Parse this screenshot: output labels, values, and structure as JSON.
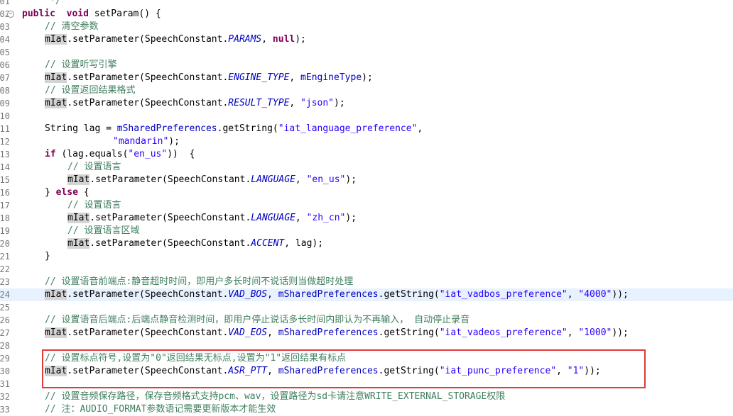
{
  "editor": {
    "annotation_color": "#e03a3a",
    "fold_icon": "collapse-icon",
    "lines": [
      {
        "no": "01",
        "indent": 0,
        "tokens": [
          [
            "cm",
            "     */"
          ]
        ]
      },
      {
        "no": "02",
        "indent": 0,
        "fold": true,
        "tokens": [
          [
            "kw",
            "public"
          ],
          [
            "",
            "  "
          ],
          [
            "kw",
            "void"
          ],
          [
            "",
            " setParam() {"
          ]
        ]
      },
      {
        "no": "03",
        "indent": 2,
        "tokens": [
          [
            "cm",
            "// 清空参数"
          ]
        ]
      },
      {
        "no": "04",
        "indent": 2,
        "tokens": [
          [
            "occ",
            "mIat"
          ],
          [
            "",
            ".setParameter(SpeechConstant."
          ],
          [
            "cst",
            "PARAMS"
          ],
          [
            "",
            ", "
          ],
          [
            "kw",
            "null"
          ],
          [
            "",
            ");"
          ]
        ]
      },
      {
        "no": "05",
        "indent": 0,
        "tokens": []
      },
      {
        "no": "06",
        "indent": 2,
        "tokens": [
          [
            "cm",
            "// 设置听写引擎"
          ]
        ]
      },
      {
        "no": "07",
        "indent": 2,
        "tokens": [
          [
            "occ",
            "mIat"
          ],
          [
            "",
            ".setParameter(SpeechConstant."
          ],
          [
            "cst",
            "ENGINE_TYPE"
          ],
          [
            "",
            ", "
          ],
          [
            "fld",
            "mEngineType"
          ],
          [
            "",
            ");"
          ]
        ]
      },
      {
        "no": "08",
        "indent": 2,
        "tokens": [
          [
            "cm",
            "// 设置返回结果格式"
          ]
        ]
      },
      {
        "no": "09",
        "indent": 2,
        "tokens": [
          [
            "occ",
            "mIat"
          ],
          [
            "",
            ".setParameter(SpeechConstant."
          ],
          [
            "cst",
            "RESULT_TYPE"
          ],
          [
            "",
            ", "
          ],
          [
            "str",
            "\"json\""
          ],
          [
            "",
            ");"
          ]
        ]
      },
      {
        "no": "10",
        "indent": 0,
        "tokens": []
      },
      {
        "no": "11",
        "indent": 2,
        "tokens": [
          [
            "",
            "String lag = "
          ],
          [
            "fld",
            "mSharedPreferences"
          ],
          [
            "",
            ".getString("
          ],
          [
            "str",
            "\"iat_language_preference\""
          ],
          [
            "",
            ","
          ]
        ]
      },
      {
        "no": "12",
        "indent": 8,
        "tokens": [
          [
            "str",
            "\"mandarin\""
          ],
          [
            "",
            ");"
          ]
        ]
      },
      {
        "no": "13",
        "indent": 2,
        "tokens": [
          [
            "kw",
            "if"
          ],
          [
            "",
            " (lag.equals("
          ],
          [
            "str",
            "\"en_us\""
          ],
          [
            "",
            "))  {"
          ]
        ]
      },
      {
        "no": "14",
        "indent": 4,
        "tokens": [
          [
            "cm",
            "// 设置语言"
          ]
        ]
      },
      {
        "no": "15",
        "indent": 4,
        "tokens": [
          [
            "occ",
            "mIat"
          ],
          [
            "",
            ".setParameter(SpeechConstant."
          ],
          [
            "cst",
            "LANGUAGE"
          ],
          [
            "",
            ", "
          ],
          [
            "str",
            "\"en_us\""
          ],
          [
            "",
            ");"
          ]
        ]
      },
      {
        "no": "16",
        "indent": 2,
        "tokens": [
          [
            "",
            "} "
          ],
          [
            "kw",
            "else"
          ],
          [
            "",
            " {"
          ]
        ]
      },
      {
        "no": "17",
        "indent": 4,
        "tokens": [
          [
            "cm",
            "// 设置语言"
          ]
        ]
      },
      {
        "no": "18",
        "indent": 4,
        "tokens": [
          [
            "occ",
            "mIat"
          ],
          [
            "",
            ".setParameter(SpeechConstant."
          ],
          [
            "cst",
            "LANGUAGE"
          ],
          [
            "",
            ", "
          ],
          [
            "str",
            "\"zh_cn\""
          ],
          [
            "",
            ");"
          ]
        ]
      },
      {
        "no": "19",
        "indent": 4,
        "tokens": [
          [
            "cm",
            "// 设置语言区域"
          ]
        ]
      },
      {
        "no": "20",
        "indent": 4,
        "tokens": [
          [
            "occ",
            "mIat"
          ],
          [
            "",
            ".setParameter(SpeechConstant."
          ],
          [
            "cst",
            "ACCENT"
          ],
          [
            "",
            ", lag);"
          ]
        ]
      },
      {
        "no": "21",
        "indent": 2,
        "tokens": [
          [
            "",
            "}"
          ]
        ]
      },
      {
        "no": "22",
        "indent": 0,
        "tokens": []
      },
      {
        "no": "23",
        "indent": 2,
        "tokens": [
          [
            "cm",
            "// 设置语音前端点:静音超时时间，即用户多长时间不说话则当做超时处理"
          ]
        ]
      },
      {
        "no": "24",
        "indent": 2,
        "current": true,
        "tokens": [
          [
            "occ",
            "mIat"
          ],
          [
            "",
            ".setParameter(SpeechConstant."
          ],
          [
            "cst",
            "VAD_BOS"
          ],
          [
            "",
            ", "
          ],
          [
            "fld",
            "mSharedPreferences"
          ],
          [
            "",
            ".getString("
          ],
          [
            "str",
            "\"iat_vadbos_preference\""
          ],
          [
            "",
            ", "
          ],
          [
            "str",
            "\"4000\""
          ],
          [
            "",
            "));"
          ]
        ]
      },
      {
        "no": "25",
        "indent": 0,
        "tokens": []
      },
      {
        "no": "26",
        "indent": 2,
        "tokens": [
          [
            "cm",
            "// 设置语音后端点:后端点静音检测时间，即用户停止说话多长时间内即认为不再输入， 自动停止录音"
          ]
        ]
      },
      {
        "no": "27",
        "indent": 2,
        "tokens": [
          [
            "occ",
            "mIat"
          ],
          [
            "",
            ".setParameter(SpeechConstant."
          ],
          [
            "cst",
            "VAD_EOS"
          ],
          [
            "",
            ", "
          ],
          [
            "fld",
            "mSharedPreferences"
          ],
          [
            "",
            ".getString("
          ],
          [
            "str",
            "\"iat_vadeos_preference\""
          ],
          [
            "",
            ", "
          ],
          [
            "str",
            "\"1000\""
          ],
          [
            "",
            "));"
          ]
        ]
      },
      {
        "no": "28",
        "indent": 0,
        "tokens": []
      },
      {
        "no": "29",
        "indent": 2,
        "tokens": [
          [
            "cm",
            "// 设置标点符号,设置为\"0\"返回结果无标点,设置为\"1\"返回结果有标点"
          ]
        ]
      },
      {
        "no": "30",
        "indent": 2,
        "tokens": [
          [
            "occ",
            "mIat"
          ],
          [
            "",
            ".setParameter(SpeechConstant."
          ],
          [
            "cst",
            "ASR_PTT"
          ],
          [
            "",
            ", "
          ],
          [
            "fld",
            "mSharedPreferences"
          ],
          [
            "",
            ".getString("
          ],
          [
            "str",
            "\"iat_punc_preference\""
          ],
          [
            "",
            ", "
          ],
          [
            "str",
            "\"1\""
          ],
          [
            "",
            "));"
          ]
        ]
      },
      {
        "no": "31",
        "indent": 0,
        "tokens": []
      },
      {
        "no": "32",
        "indent": 2,
        "tokens": [
          [
            "cm",
            "// 设置音频保存路径，保存音频格式支持pcm、wav，设置路径为sd卡请注意WRITE_EXTERNAL_STORAGE权限"
          ]
        ]
      },
      {
        "no": "33",
        "indent": 2,
        "tokens": [
          [
            "cm",
            "// 注：AUDIO_FORMAT参数语记需要更新版本才能生效"
          ]
        ]
      }
    ]
  }
}
